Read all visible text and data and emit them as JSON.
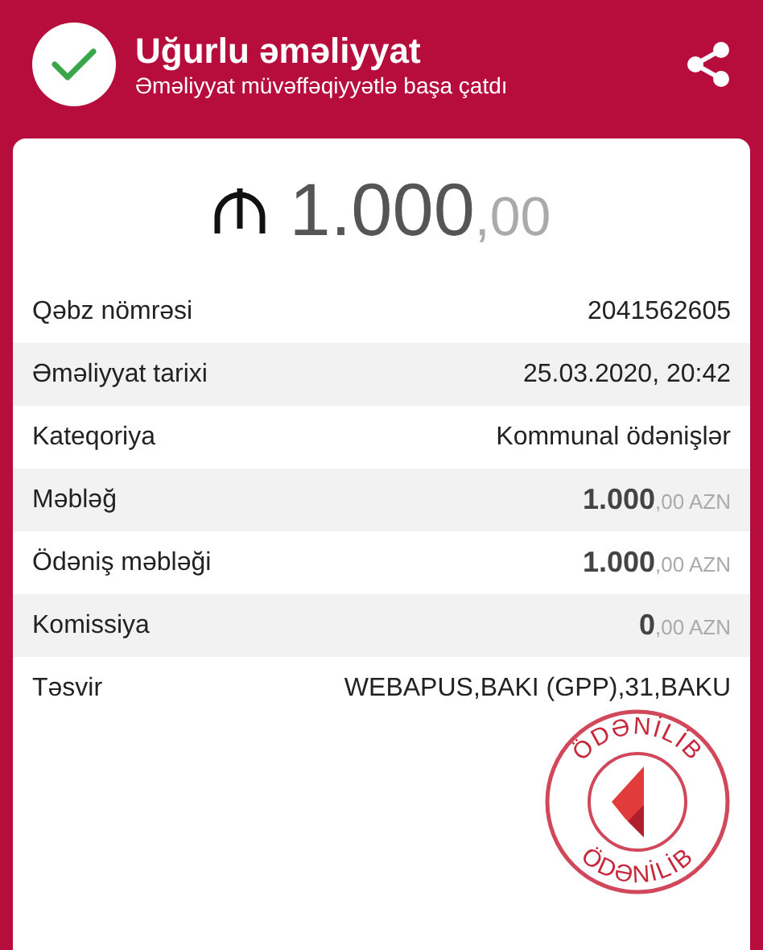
{
  "header": {
    "title": "Uğurlu əməliyyat",
    "subtitle": "Əməliyyat müvəffəqiyyətlə başa çatdı"
  },
  "total": {
    "main": "1.000",
    "decimal": ",00"
  },
  "rows": [
    {
      "kind": "text",
      "label": "Qəbz nömrəsi",
      "value": "2041562605"
    },
    {
      "kind": "text",
      "label": "Əməliyyat tarixi",
      "value": "25.03.2020, 20:42"
    },
    {
      "kind": "text",
      "label": "Kateqoriya",
      "value": "Kommunal ödənişlər"
    },
    {
      "kind": "money",
      "label": "Məbləğ",
      "main": "1.000",
      "decimal": ",00",
      "currency": "AZN"
    },
    {
      "kind": "money",
      "label": "Ödəniş məbləği",
      "main": "1.000",
      "decimal": ",00",
      "currency": "AZN"
    },
    {
      "kind": "money",
      "label": "Komissiya",
      "main": "0",
      "decimal": ",00",
      "currency": "AZN"
    },
    {
      "kind": "text",
      "label": "Təsvir",
      "value": "WEBAPUS,BAKI (GPP),31,BAKU"
    }
  ],
  "stamp": {
    "top_text": "ÖDƏNİLİB",
    "bottom_text": "ÖDƏNİLİB"
  }
}
